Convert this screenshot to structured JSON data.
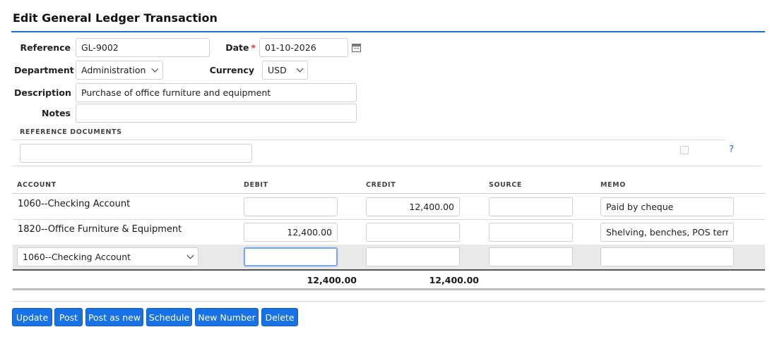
{
  "page": {
    "title": "Edit General Ledger Transaction"
  },
  "form": {
    "reference_label": "Reference",
    "reference_value": "GL-9002",
    "date_label": "Date",
    "date_required_mark": "*",
    "date_value": "01-10-2026",
    "department_label": "Department",
    "department_value": "Administration",
    "currency_label": "Currency",
    "currency_value": "USD",
    "description_label": "Description",
    "description_value": "Purchase of office furniture and equipment",
    "notes_label": "Notes",
    "notes_value": ""
  },
  "reference_documents": {
    "heading": "REFERENCE DOCUMENTS",
    "input_value": "",
    "help_link": "?"
  },
  "lines": {
    "headers": {
      "account": "ACCOUNT",
      "debit": "DEBIT",
      "credit": "CREDIT",
      "source": "SOURCE",
      "memo": "MEMO"
    },
    "rows": [
      {
        "account": "1060--Checking Account",
        "debit": "",
        "credit": "12,400.00",
        "source": "",
        "memo": "Paid by cheque"
      },
      {
        "account": "1820--Office Furniture & Equipment",
        "debit": "12,400.00",
        "credit": "",
        "source": "",
        "memo": "Shelving, benches, POS terminal"
      },
      {
        "account": "1060--Checking Account",
        "debit": "",
        "credit": "",
        "source": "",
        "memo": ""
      }
    ],
    "totals": {
      "debit": "12,400.00",
      "credit": "12,400.00"
    }
  },
  "buttons": {
    "update": "Update",
    "post": "Post",
    "post_as_new": "Post as new",
    "schedule": "Schedule",
    "new_number": "New Number",
    "delete": "Delete"
  },
  "colors": {
    "accent": "#1672e6",
    "title_rule": "#1f6fd1",
    "required": "#d33333"
  }
}
